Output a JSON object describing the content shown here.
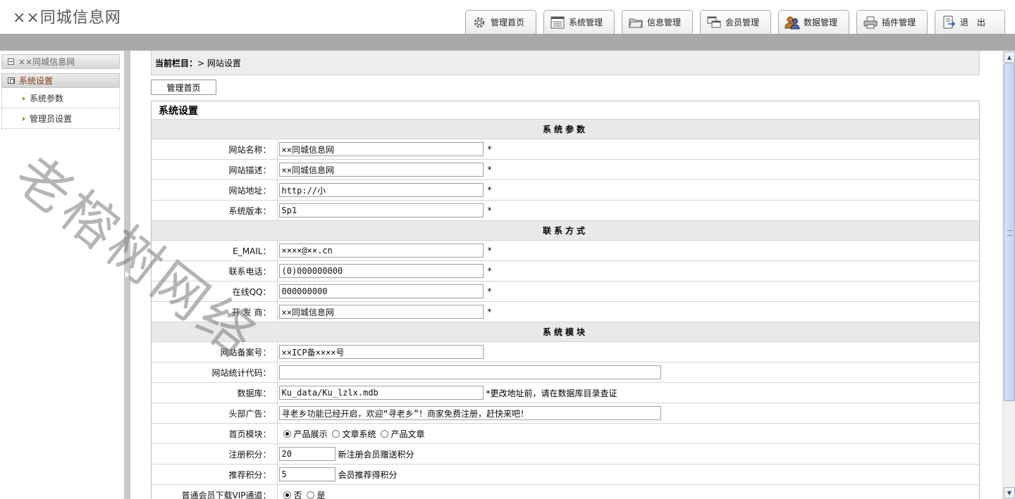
{
  "header": {
    "site_title": "××同城信息网",
    "nav_tabs": [
      {
        "label": "管理首页",
        "icon": "gear-icon"
      },
      {
        "label": "系统管理",
        "icon": "list-icon"
      },
      {
        "label": "信息管理",
        "icon": "folder-icon"
      },
      {
        "label": "会员管理",
        "icon": "windows-icon"
      },
      {
        "label": "数据管理",
        "icon": "users-icon"
      },
      {
        "label": "插件管理",
        "icon": "printer-icon"
      },
      {
        "label": "退　出",
        "icon": "logout-icon"
      }
    ]
  },
  "sidebar": {
    "root_label": "××同城信息网",
    "group_label": "系统设置",
    "items": [
      {
        "label": "系统参数"
      },
      {
        "label": "管理员设置"
      }
    ]
  },
  "breadcrumb": {
    "prefix": "当前栏目：",
    "current": "> 网站设置"
  },
  "home_button": "管理首页",
  "panel_title": "系统设置",
  "sections": {
    "params": "系统参数",
    "contact": "联系方式",
    "modules": "系统模块"
  },
  "fields": {
    "site_name": {
      "label": "网站名称：",
      "value": "××同城信息网",
      "required": "*"
    },
    "site_desc": {
      "label": "网站描述：",
      "value": "××同城信息网",
      "required": "*"
    },
    "site_url": {
      "label": "网站地址：",
      "value": "http://小",
      "required": "*"
    },
    "sys_version": {
      "label": "系统版本：",
      "value": "Sp1",
      "required": "*"
    },
    "email": {
      "label": "E_MAIL：",
      "value": "××××@××.cn",
      "required": "*"
    },
    "phone": {
      "label": "联系电话：",
      "value": "(0)000000000",
      "required": "*"
    },
    "qq": {
      "label": "在线QQ：",
      "value": "000000000",
      "required": "*"
    },
    "developer": {
      "label": "开 发 商：",
      "value": "××同城信息网",
      "required": "*"
    },
    "icp": {
      "label": "网站备案号：",
      "value": "××ICP备××××号"
    },
    "stats_code": {
      "label": "网站统计代码：",
      "value": ""
    },
    "database": {
      "label": "数据库：",
      "value": "Ku_data/Ku_lzlx.mdb",
      "note": "*更改地址前，请在数据库目录查证"
    },
    "header_ad": {
      "label": "头部广告：",
      "value": "寻老乡功能已经开启，欢迎“寻老乡”！商家免费注册，赶快来吧！"
    },
    "home_module": {
      "label": "首页模块：",
      "options": [
        "产品展示",
        "文章系统",
        "产品文章"
      ],
      "selected": "产品展示"
    },
    "register_points": {
      "label": "注册积分：",
      "value": "20",
      "note": "新注册会员赠送积分"
    },
    "referral_points": {
      "label": "推荐积分：",
      "value": "5",
      "note": "会员推荐得积分"
    },
    "vip_download": {
      "label": "普通会员下载VIP通道：",
      "options": [
        "否",
        "是"
      ],
      "selected": "否"
    }
  },
  "watermark": "老榕树网络",
  "colors": {
    "header_bar": "#a9a9a9",
    "section_bg": "#e9e9e9",
    "sidebar_group_text": "#8b3a10",
    "scroll_thumb": "#c4d0ee"
  }
}
